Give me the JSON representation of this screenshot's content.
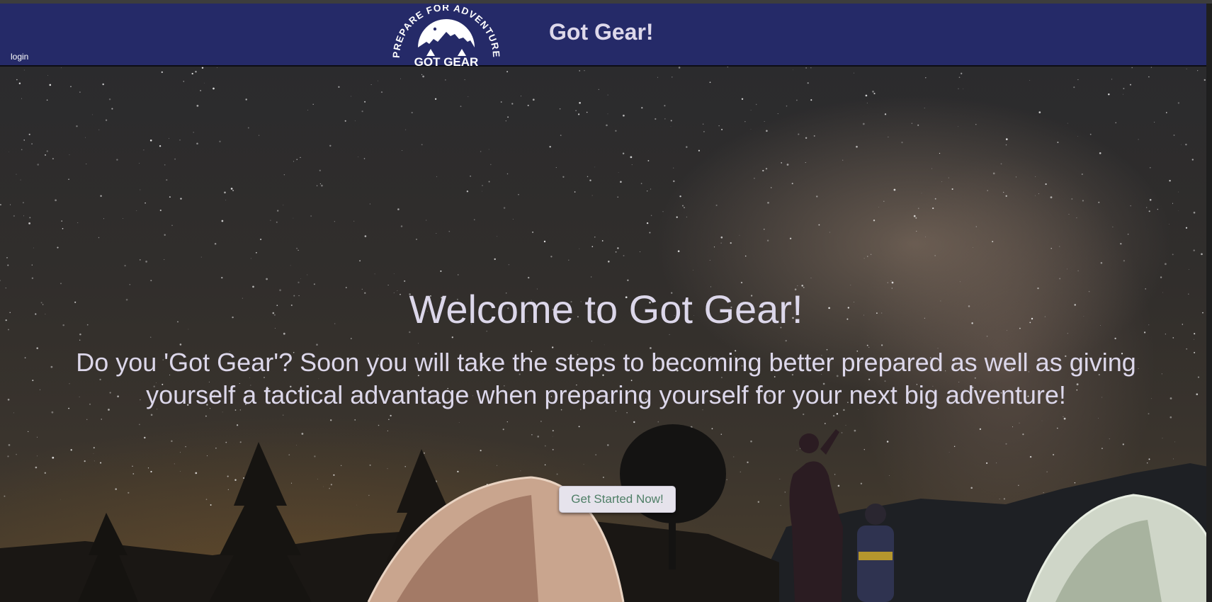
{
  "header": {
    "login_label": "login",
    "site_title": "Got Gear!",
    "logo": {
      "arc_text": "PREPARE FOR ADVENTURE",
      "brand_text": "GOT GEAR",
      "icon": "mountain-camp-logo-icon"
    }
  },
  "hero": {
    "title": "Welcome to Got Gear!",
    "text": "Do you 'Got Gear'? Soon you will take the steps to becoming better prepared as well as giving yourself a tactical advantage when preparing yourself for your next big adventure!",
    "cta_label": "Get Started Now!",
    "background_icon": "night-sky-campsite-photo"
  },
  "colors": {
    "header_bg": "#252a68",
    "title_text": "#ddd8ea",
    "cta_text": "#4f7f67"
  }
}
